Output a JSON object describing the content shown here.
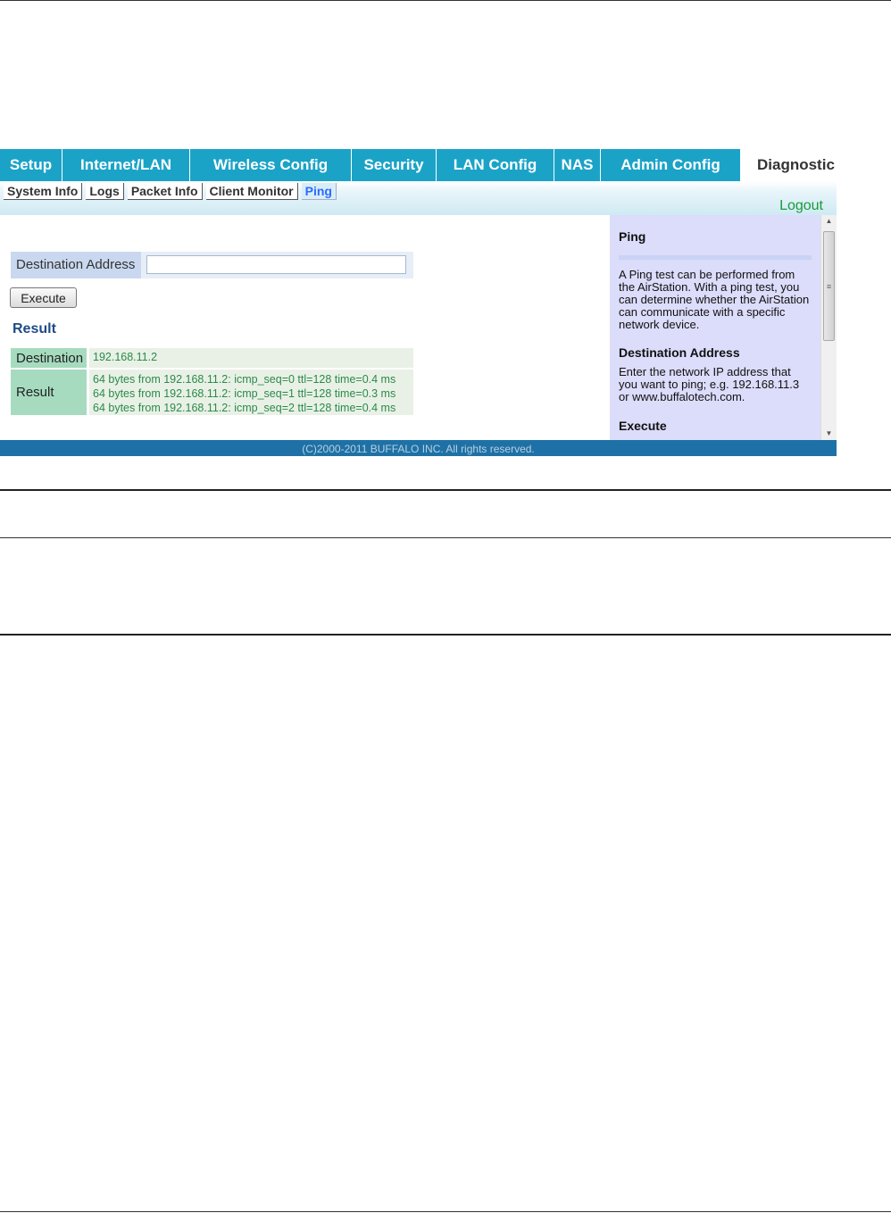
{
  "main_tabs": [
    {
      "label": "Setup",
      "active": false
    },
    {
      "label": "Internet/LAN",
      "active": false
    },
    {
      "label": "Wireless Config",
      "active": false
    },
    {
      "label": "Security",
      "active": false
    },
    {
      "label": "LAN Config",
      "active": false
    },
    {
      "label": "NAS",
      "active": false
    },
    {
      "label": "Admin Config",
      "active": false
    },
    {
      "label": "Diagnostic",
      "active": true
    }
  ],
  "sub_tabs": [
    {
      "label": "System Info",
      "active": false
    },
    {
      "label": "Logs",
      "active": false
    },
    {
      "label": "Packet Info",
      "active": false
    },
    {
      "label": "Client Monitor",
      "active": false
    },
    {
      "label": "Ping",
      "active": true
    }
  ],
  "logout_label": "Logout",
  "form": {
    "destination_label": "Destination Address",
    "destination_value": "",
    "execute_label": "Execute"
  },
  "result": {
    "heading": "Result",
    "destination_label": "Destination",
    "destination_value": "192.168.11.2",
    "result_label": "Result",
    "lines": [
      "64 bytes from 192.168.11.2: icmp_seq=0 ttl=128 time=0.4 ms",
      "64 bytes from 192.168.11.2: icmp_seq=1 ttl=128 time=0.3 ms",
      "64 bytes from 192.168.11.2: icmp_seq=2 ttl=128 time=0.4 ms"
    ]
  },
  "help": {
    "title": "Ping",
    "intro": "A Ping test can be performed from the AirStation. With a ping test, you can determine whether the AirStation can communicate with a specific network device.",
    "dest_heading": "Destination Address",
    "dest_text": "Enter the network IP address that you want to ping; e.g. 192.168.11.3 or www.buffalotech.com.",
    "exec_heading": "Execute"
  },
  "footer": "(C)2000-2011 BUFFALO INC. All rights reserved.",
  "colors": {
    "nav": "#1ba3c7",
    "footer": "#1e71a6",
    "help_bg": "#dcdcfb",
    "result_label": "#a6dbbf"
  }
}
